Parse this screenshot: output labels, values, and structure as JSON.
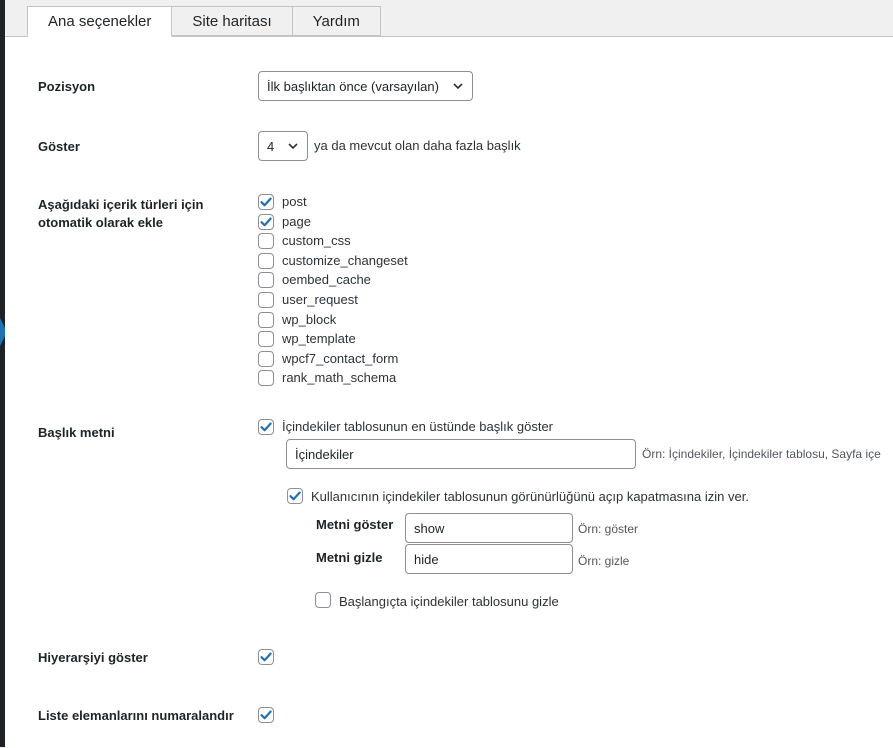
{
  "tabs": [
    {
      "label": "Ana seçenekler",
      "active": true
    },
    {
      "label": "Site haritası",
      "active": false
    },
    {
      "label": "Yardım",
      "active": false
    }
  ],
  "position": {
    "label": "Pozisyon",
    "selected": "İlk başlıktan önce (varsayılan)"
  },
  "show": {
    "label": "Göster",
    "selected": "4",
    "suffix": "ya da mevcut olan daha fazla başlık"
  },
  "auto_insert": {
    "label_line1": "Aşağıdaki içerik türleri için",
    "label_line2": "otomatik olarak ekle",
    "items": [
      {
        "label": "post",
        "checked": true
      },
      {
        "label": "page",
        "checked": true
      },
      {
        "label": "custom_css",
        "checked": false
      },
      {
        "label": "customize_changeset",
        "checked": false
      },
      {
        "label": "oembed_cache",
        "checked": false
      },
      {
        "label": "user_request",
        "checked": false
      },
      {
        "label": "wp_block",
        "checked": false
      },
      {
        "label": "wp_template",
        "checked": false
      },
      {
        "label": "wpcf7_contact_form",
        "checked": false
      },
      {
        "label": "rank_math_schema",
        "checked": false
      }
    ]
  },
  "heading_text": {
    "label": "Başlık metni",
    "show_heading_label": "İçindekiler tablosunun en üstünde başlık göster",
    "show_heading_checked": true,
    "heading_value": "İçindekiler",
    "heading_hint": "Örn: İçindekiler, İçindekiler tablosu, Sayfa içe",
    "toggle_label": "Kullanıcının içindekiler tablosunun görünürlüğünü açıp kapatmasına izin ver.",
    "toggle_checked": true,
    "show_text_label": "Metni göster",
    "show_text_value": "show",
    "show_text_hint": "Örn: göster",
    "hide_text_label": "Metni gizle",
    "hide_text_value": "hide",
    "hide_text_hint": "Örn: gizle",
    "hide_initially_label": "Başlangıçta içindekiler tablosunu gizle",
    "hide_initially_checked": false
  },
  "hierarchy": {
    "label": "Hiyerarşiyi göster",
    "checked": true
  },
  "numbering": {
    "label": "Liste elemanlarını numaralandır",
    "checked": true
  },
  "colors": {
    "accent": "#2271b1",
    "border": "#8c8f94",
    "text": "#1d2327"
  }
}
